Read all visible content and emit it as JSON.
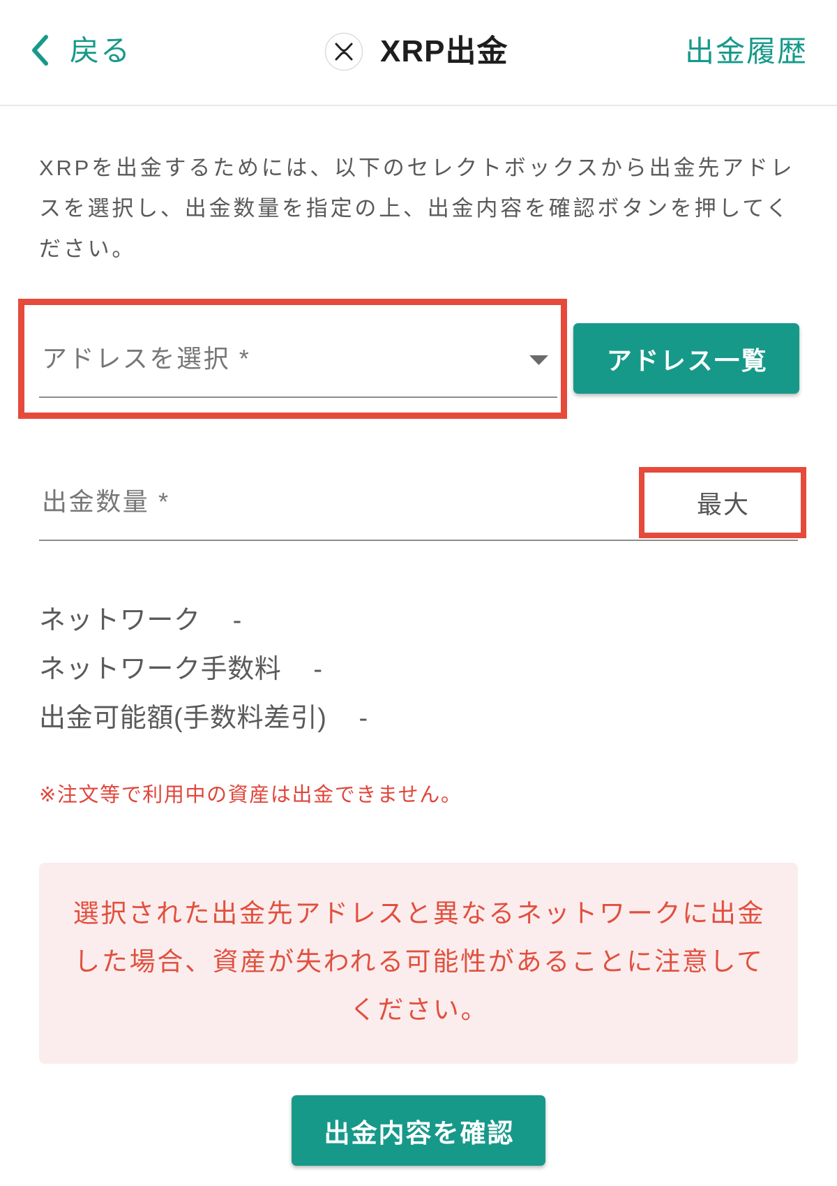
{
  "header": {
    "back_label": "戻る",
    "title": "XRP出金",
    "history_link": "出金履歴"
  },
  "icons": {
    "back": "chevron-left-icon",
    "coin": "xrp-icon",
    "dropdown": "caret-down-icon"
  },
  "intro_text": "XRPを出金するためには、以下のセレクトボックスから出金先アドレスを選択し、出金数量を指定の上、出金内容を確認ボタンを押してください。",
  "address": {
    "placeholder": "アドレスを選択 *",
    "list_button": "アドレス一覧"
  },
  "amount": {
    "placeholder": "出金数量 *",
    "max_button": "最大"
  },
  "details": [
    {
      "label": "ネットワーク",
      "value": "-"
    },
    {
      "label": "ネットワーク手数料",
      "value": "-"
    },
    {
      "label": "出金可能額(手数料差引)",
      "value": "-"
    }
  ],
  "notice": "※注文等で利用中の資産は出金できません。",
  "warning": "選択された出金先アドレスと異なるネットワークに出金した場合、資産が失われる可能性があることに注意してください。",
  "confirm_button": "出金内容を確認",
  "colors": {
    "accent": "#17998a",
    "highlight": "#e64a3b",
    "warning_text": "#e1503f",
    "warning_bg": "#fbeded",
    "notice_text": "#e0453a"
  }
}
